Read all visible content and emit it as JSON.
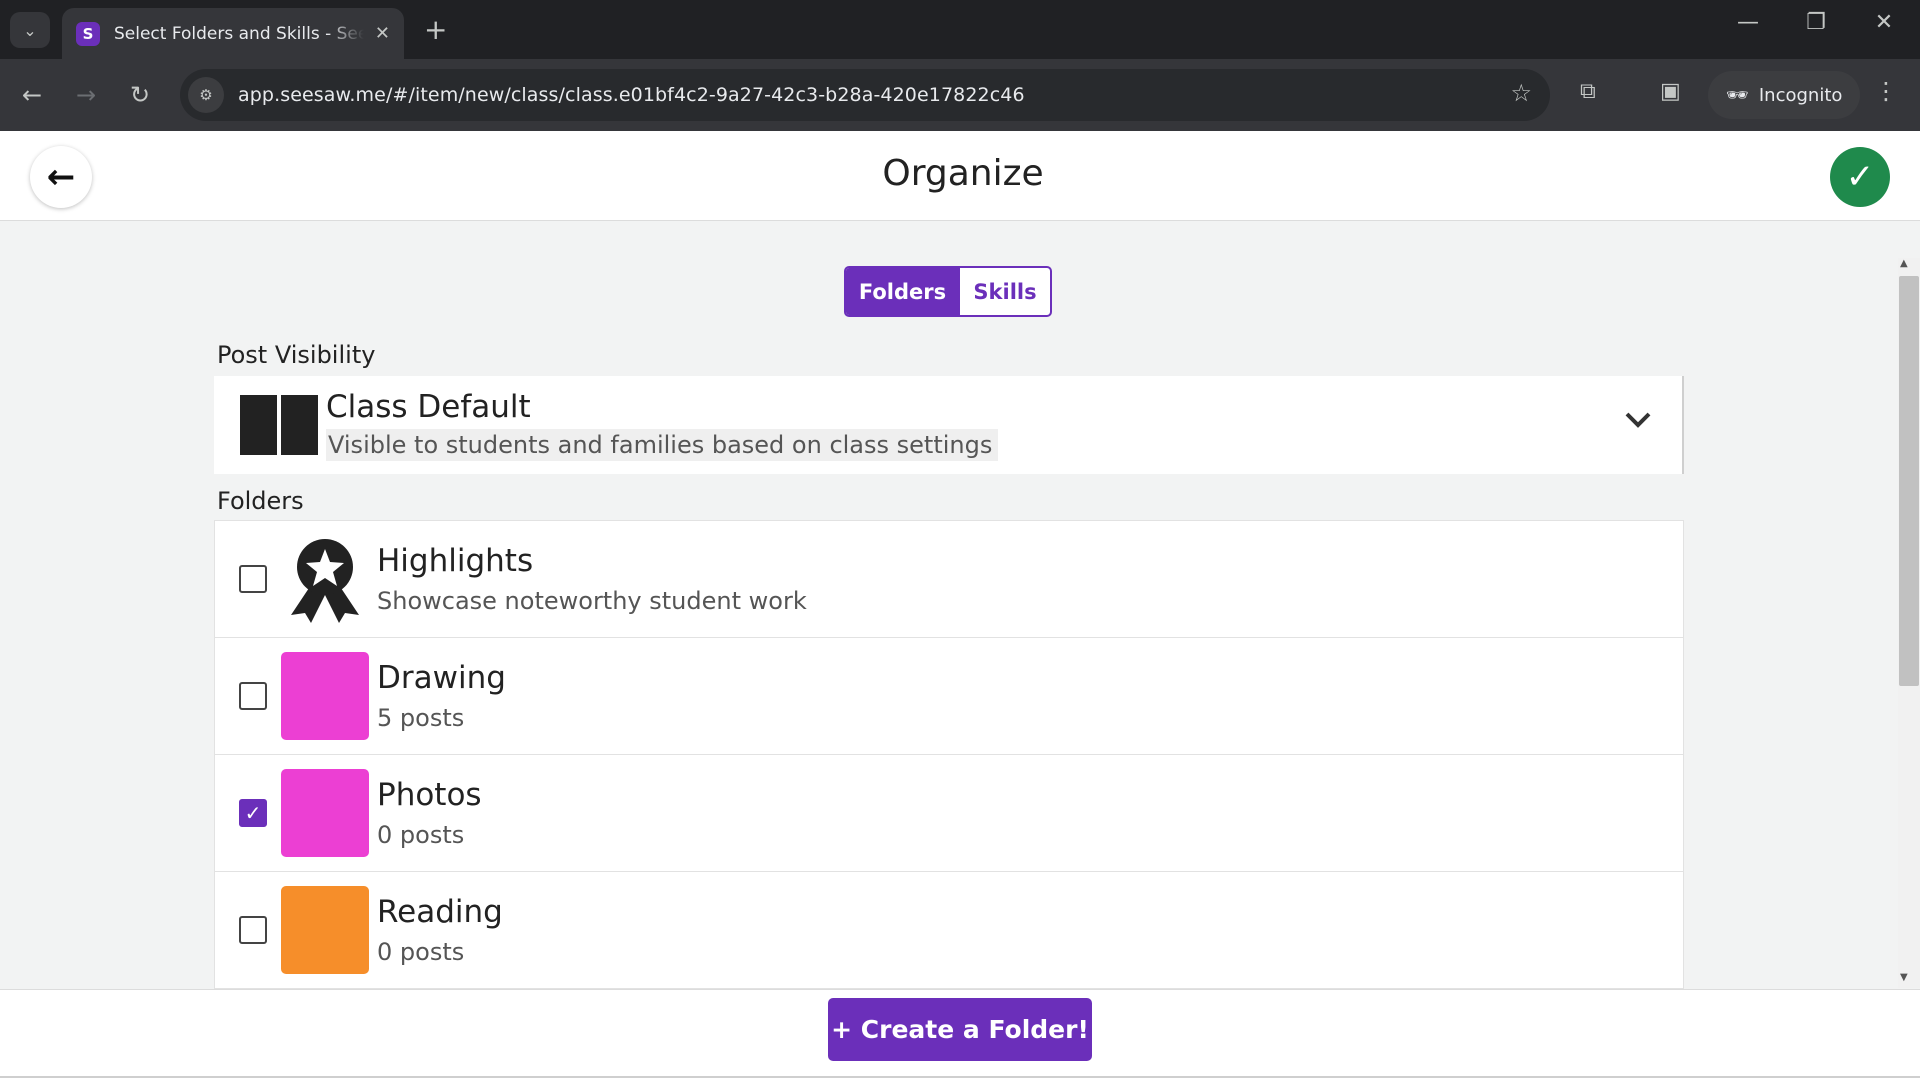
{
  "browser": {
    "tab_title": "Select Folders and Skills - Seesaw",
    "url": "app.seesaw.me/#/item/new/class/class.e01bf4c2-9a27-42c3-b28a-420e17822c46",
    "incognito_label": "Incognito"
  },
  "header": {
    "title": "Organize"
  },
  "segmented": {
    "folders_label": "Folders",
    "skills_label": "Skills",
    "active": "Folders"
  },
  "visibility": {
    "section_label": "Post Visibility",
    "title": "Class Default",
    "subtitle": "Visible to students and families based on class settings"
  },
  "folders": {
    "section_label": "Folders",
    "items": [
      {
        "name": "Highlights",
        "subtitle": "Showcase noteworthy student work",
        "checked": false,
        "icon": "award-ribbon-icon"
      },
      {
        "name": "Drawing",
        "subtitle": "5 posts",
        "checked": false,
        "color": "#ec3fd3"
      },
      {
        "name": "Photos",
        "subtitle": "0 posts",
        "checked": true,
        "color": "#ec3fd3"
      },
      {
        "name": "Reading",
        "subtitle": "0 posts",
        "checked": false,
        "color": "#f68e2a"
      }
    ]
  },
  "footer": {
    "create_label": "+ Create a Folder!"
  },
  "colors": {
    "accent": "#6b2fba",
    "done_green": "#1f8a4c"
  }
}
